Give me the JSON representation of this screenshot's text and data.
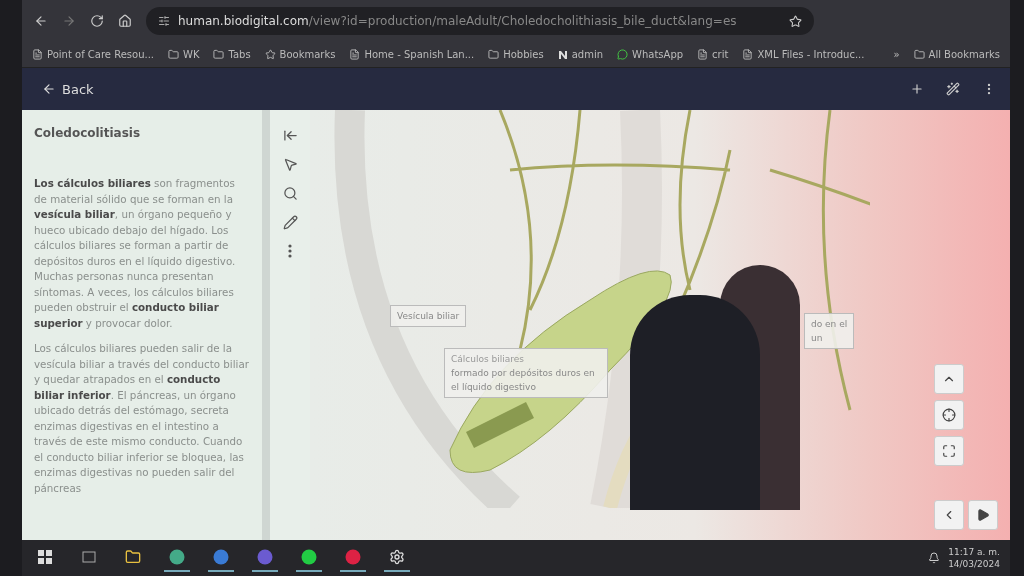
{
  "browser": {
    "url_host": "human.biodigital.com",
    "url_path": "/view?id=production/maleAdult/Choledocholithiasis_bile_duct&lang=es",
    "bookmarks": [
      {
        "kind": "page",
        "label": "Point of Care Resou..."
      },
      {
        "kind": "folder",
        "label": "WK"
      },
      {
        "kind": "folder",
        "label": "Tabs"
      },
      {
        "kind": "star",
        "label": "Bookmarks"
      },
      {
        "kind": "page",
        "label": "Home - Spanish Lan..."
      },
      {
        "kind": "folder",
        "label": "Hobbies"
      },
      {
        "kind": "n",
        "label": "admin"
      },
      {
        "kind": "chat",
        "label": "WhatsApp"
      },
      {
        "kind": "page",
        "label": "crit"
      },
      {
        "kind": "page",
        "label": "XML Files - Introduc..."
      }
    ],
    "more": "»",
    "all_bookmarks": "All Bookmarks"
  },
  "header": {
    "back": "Back"
  },
  "panel": {
    "title": "Coledocolitiasis",
    "paragraphs": [
      "**Los cálculos biliares** son fragmentos de material sólido que se forman en la **vesícula biliar**, un órgano pequeño y hueco ubicado debajo del hígado. Los cálculos biliares se forman a partir de depósitos duros en el líquido digestivo. Muchas personas nunca presentan síntomas. A veces, los cálculos biliares pueden obstruir el **conducto biliar superior** y provocar dolor.",
      "Los cálculos biliares pueden salir de la vesícula biliar a través del conducto biliar y quedar atrapados en el **conducto biliar inferior**. El páncreas, un órgano ubicado detrás del estómago, secreta enzimas digestivas en el intestino a través de este mismo conducto. Cuando el conducto biliar inferior se bloquea, las enzimas digestivas no pueden salir del páncreas"
    ]
  },
  "viewer": {
    "labels": [
      {
        "kind": "tag",
        "lines": [
          "Vesícula biliar"
        ]
      },
      {
        "kind": "card",
        "lines": [
          "Cálculos biliares",
          "formado por depósitos duros en el líquido digestivo"
        ]
      },
      {
        "kind": "partial",
        "lines": [
          "do en el",
          "un"
        ]
      }
    ]
  },
  "taskbar": {
    "apps": [
      {
        "kind": "start",
        "active": false
      },
      {
        "kind": "taskview",
        "active": false
      },
      {
        "kind": "files",
        "active": false
      },
      {
        "kind": "chrome",
        "active": true
      },
      {
        "kind": "outlook",
        "active": true
      },
      {
        "kind": "teams",
        "active": true
      },
      {
        "kind": "spotify",
        "active": true
      },
      {
        "kind": "powerpoint",
        "active": true
      },
      {
        "kind": "settings",
        "active": true
      }
    ],
    "time": "11:17 a. m.",
    "date": "14/03/2024"
  }
}
